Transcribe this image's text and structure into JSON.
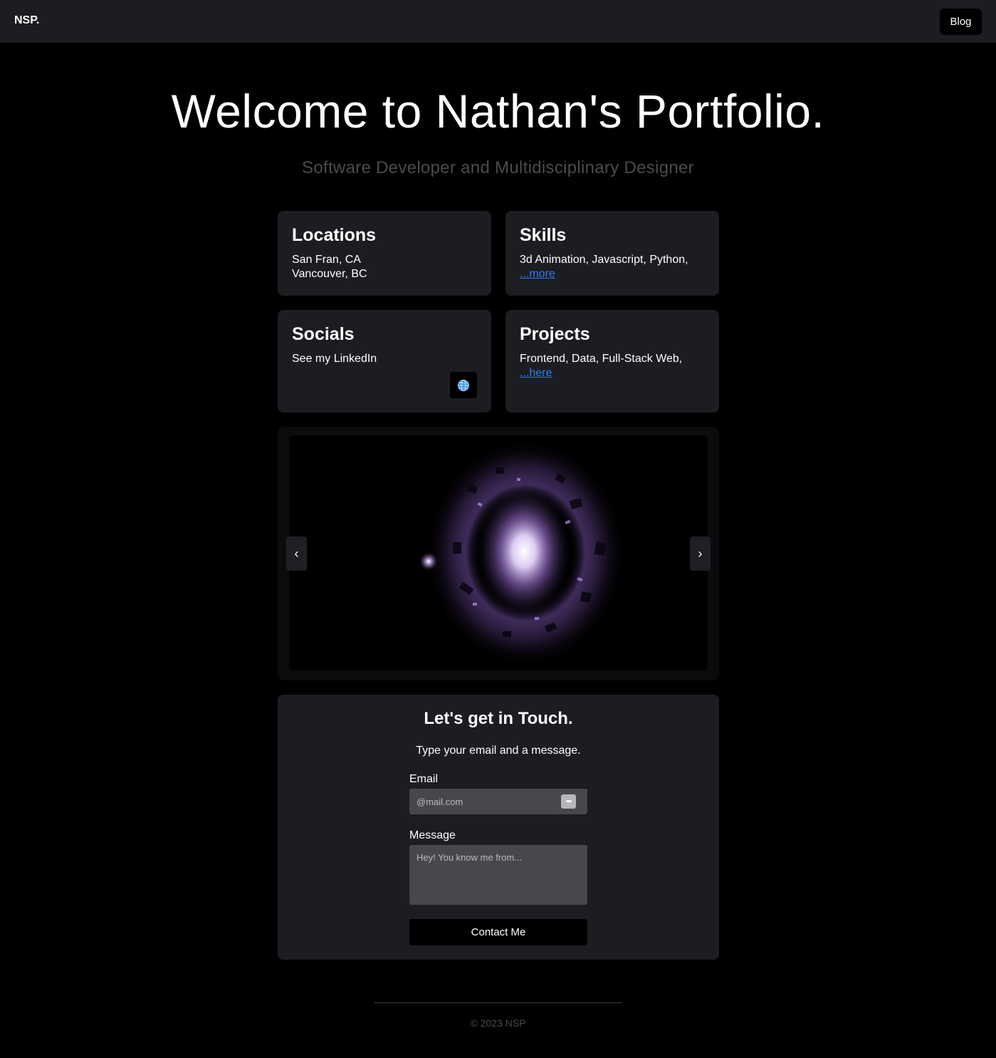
{
  "header": {
    "logo": "NSP.",
    "blog_label": "Blog"
  },
  "hero": {
    "title": "Welcome to Nathan's Portfolio.",
    "subtitle": "Software Developer and Multidisciplinary Designer"
  },
  "cards": {
    "locations": {
      "title": "Locations",
      "lines": [
        "San Fran, CA",
        "Vancouver, BC"
      ]
    },
    "skills": {
      "title": "Skills",
      "text": "3d Animation, Javascript, Python,",
      "link": "...more"
    },
    "socials": {
      "title": "Socials",
      "text": "See my LinkedIn",
      "icon": "globe-icon"
    },
    "projects": {
      "title": "Projects",
      "text": "Frontend, Data, Full-Stack Web,",
      "link": "...here"
    }
  },
  "carousel": {
    "prev": "‹",
    "next": "›"
  },
  "contact": {
    "title": "Let's get in Touch.",
    "hint": "Type your email and a message.",
    "email_label": "Email",
    "email_placeholder": "@mail.com",
    "message_label": "Message",
    "message_placeholder": "Hey! You know me from...",
    "submit_label": "Contact Me"
  },
  "footer": {
    "copyright": "© 2023 NSP"
  },
  "colors": {
    "background": "#000000",
    "surface": "#1c1d20",
    "link": "#2e7bf0",
    "accent_glow": "#b48ce6"
  }
}
